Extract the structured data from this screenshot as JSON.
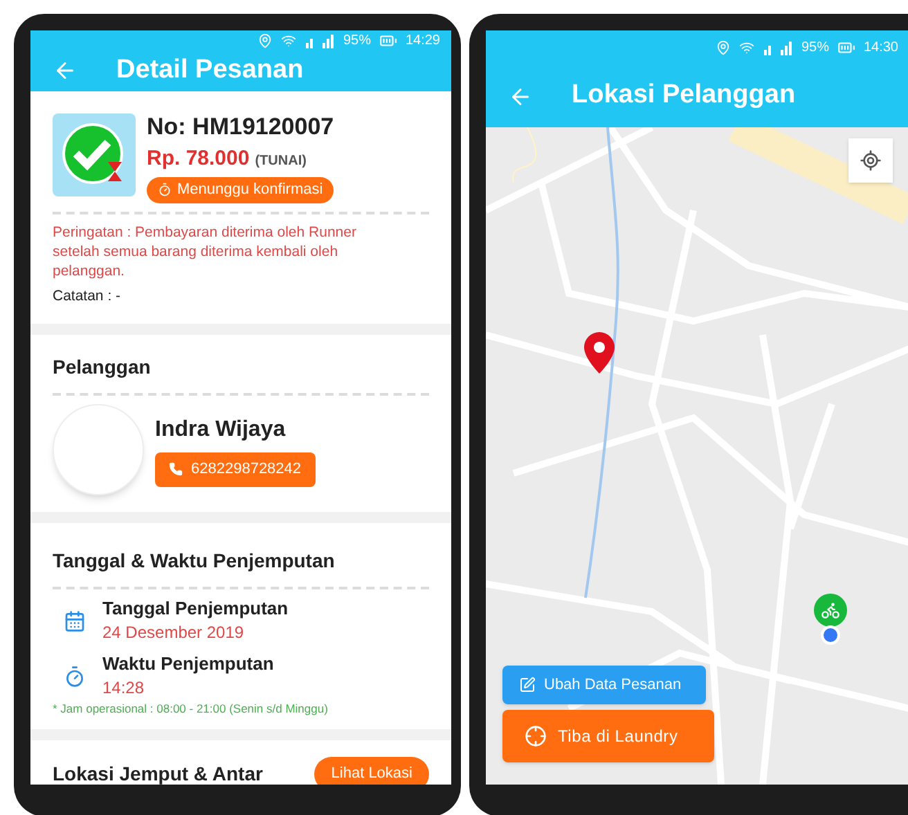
{
  "detail_screen": {
    "status_bar": {
      "battery": "95%",
      "time": "14:29"
    },
    "title": "Detail Pesanan",
    "order": {
      "number": "No: HM19120007",
      "price": "Rp. 78.000",
      "payment": "(TUNAI)",
      "status": "Menunggu konfirmasi",
      "warning": "Peringatan : Pembayaran diterima oleh Runner setelah semua barang diterima kembali oleh pelanggan.",
      "note": "Catatan : -"
    },
    "customer": {
      "heading": "Pelanggan",
      "name": "Indra Wijaya",
      "phone": "6282298728242"
    },
    "pickup": {
      "heading": "Tanggal & Waktu Penjemputan",
      "items": [
        {
          "kind": "date",
          "label": "Tanggal Penjemputan",
          "value": "24 Desember 2019"
        },
        {
          "kind": "time",
          "label": "Waktu Penjemputan",
          "value": "14:28"
        }
      ],
      "hours_note": "* Jam operasional : 08:00 - 21:00 (Senin s/d Minggu)"
    },
    "location": {
      "heading": "Lokasi Jemput & Antar",
      "button": "Lihat Lokasi"
    }
  },
  "map_screen": {
    "status_bar": {
      "battery": "95%",
      "time": "14:30"
    },
    "title": "Lokasi Pelanggan",
    "buttons": [
      {
        "kind": "edit",
        "label": "Ubah Data Pesanan"
      },
      {
        "kind": "arrive",
        "label": "Tiba di Laundry"
      }
    ]
  }
}
